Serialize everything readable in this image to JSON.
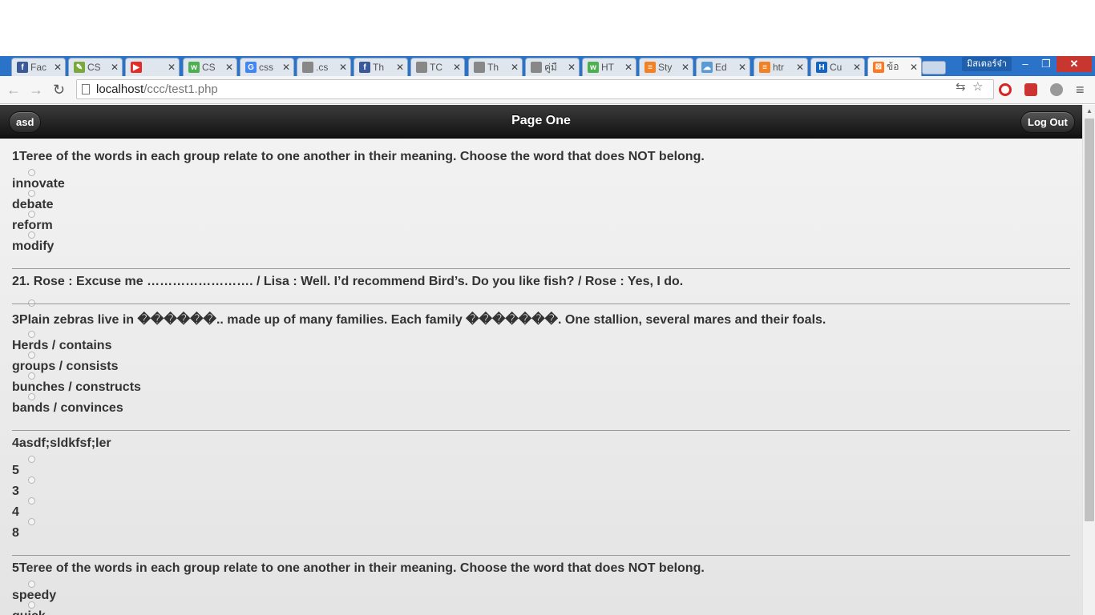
{
  "browser": {
    "tabs": [
      {
        "label": "Fac",
        "icon": "facebook-icon",
        "color": "#3b5998",
        "glyph": "f"
      },
      {
        "label": "CS",
        "icon": "feather-icon",
        "color": "#7aa83b",
        "glyph": "✎"
      },
      {
        "label": "",
        "icon": "youtube-icon",
        "color": "#e52d27",
        "glyph": "▶"
      },
      {
        "label": "CS",
        "icon": "w3-icon",
        "color": "#4caf50",
        "glyph": "w"
      },
      {
        "label": "css",
        "icon": "google-icon",
        "color": "#4285f4",
        "glyph": "G"
      },
      {
        "label": ".cs",
        "icon": "page-icon",
        "color": "#888888",
        "glyph": ""
      },
      {
        "label": "Th",
        "icon": "facebook-icon",
        "color": "#3b5998",
        "glyph": "f"
      },
      {
        "label": "TC",
        "icon": "page-icon",
        "color": "#888888",
        "glyph": ""
      },
      {
        "label": "Th",
        "icon": "page-icon",
        "color": "#888888",
        "glyph": ""
      },
      {
        "label": "คู่มื",
        "icon": "page-icon",
        "color": "#888888",
        "glyph": ""
      },
      {
        "label": "HT",
        "icon": "w3-icon",
        "color": "#4caf50",
        "glyph": "w"
      },
      {
        "label": "Sty",
        "icon": "stackoverflow-icon",
        "color": "#f48024",
        "glyph": "≡"
      },
      {
        "label": "Ed",
        "icon": "cloud-icon",
        "color": "#5b9bd5",
        "glyph": "☁"
      },
      {
        "label": "htr",
        "icon": "stackoverflow-icon",
        "color": "#f48024",
        "glyph": "≡"
      },
      {
        "label": "Cu",
        "icon": "h-icon",
        "color": "#1565c0",
        "glyph": "H"
      },
      {
        "label": "ข้อ",
        "icon": "xampp-icon",
        "color": "#fb7a24",
        "glyph": "⊠",
        "active": true
      }
    ],
    "profile_name": "มิสเตอร์จ๋า",
    "url_host": "localhost",
    "url_path": "/ccc/test1.php"
  },
  "header": {
    "title": "Page One",
    "left_button": "asd",
    "logout_button": "Log Out"
  },
  "questions": [
    {
      "title": "1Teree of the words in each group relate to one another in their meaning. Choose the word that does NOT belong.",
      "options": [
        "innovate",
        "debate",
        "reform",
        "modify"
      ]
    },
    {
      "title": "21. Rose : Excuse me ……………………. / Lisa : Well. I’d recommend Bird’s. Do you like fish? / Rose : Yes, I do.",
      "options": []
    },
    {
      "title": "3Plain zebras live in ������.. made up of many families. Each family �������. One stallion, several mares and their foals.",
      "options": [
        "Herds / contains",
        "groups / consists",
        "bunches / constructs",
        "bands / convinces"
      ]
    },
    {
      "title": "4asdf;sldkfsf;ler",
      "options": [
        "5",
        "3",
        "4",
        "8"
      ]
    },
    {
      "title": "5Teree of the words in each group relate to one another in their meaning. Choose the word that does NOT belong.",
      "options": [
        "speedy",
        "quick"
      ]
    }
  ]
}
